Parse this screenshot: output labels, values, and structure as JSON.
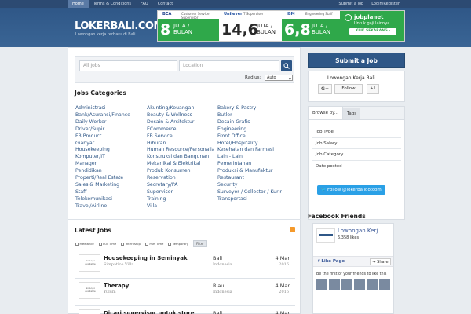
{
  "topnav": {
    "items": [
      "Home",
      "Terms & Conditions",
      "FAQ",
      "Contact"
    ],
    "right": [
      "Submit a Job",
      "Login/Register"
    ]
  },
  "header": {
    "logo": "LOKERBALI.COM",
    "tagline": "Lowongan kerja terbaru di Bali"
  },
  "ad": {
    "offers": [
      {
        "brand": "BCA",
        "position": "Customer Service Supervisor",
        "value": "8",
        "unit1": "JUTA /",
        "unit2": "BULAN"
      },
      {
        "brand": "Unilever",
        "position": "IT Supervisor",
        "value": "14,6",
        "unit1": "JUTA /",
        "unit2": "BULAN"
      },
      {
        "brand": "IBM",
        "position": "Engineering Staff",
        "value": "6,8",
        "unit1": "JUTA /",
        "unit2": "BULAN"
      }
    ],
    "jobplanet": {
      "name": "jobplanet",
      "sub": "Untuk gaji lainnya",
      "button": "KLIK SEKARANG ›"
    }
  },
  "search": {
    "jobs_placeholder": "All Jobs",
    "location_placeholder": "Location",
    "radius_label": "Radius:",
    "radius_value": "Auto"
  },
  "categories": {
    "title": "Jobs Categories",
    "col1": [
      "Administrasi",
      "Bank/Asuransi/Finance",
      "Daily Worker",
      "Driver/Supir",
      "FB Product",
      "Gianyar",
      "Housekeeping",
      "Komputer/IT",
      "Manager",
      "Pendidikan",
      "Properti/Real Estate",
      "Sales & Marketing",
      "Staff",
      "Telekomunikasi",
      "Travel/Airline"
    ],
    "col2": [
      "Akunting/Keuangan",
      "Beauty & Wellness",
      "Desain & Arsitektur",
      "ECommerce",
      "FB Service",
      "Hiburan",
      "Human Resource/Personalia",
      "Konstruksi dan Bangunan",
      "Mekanikal & Elektrikal",
      "Produk Konsumen",
      "Reservation",
      "Secretary/PA",
      "Supervisor",
      "Training",
      "Villa"
    ],
    "col3": [
      "Bakery & Pastry",
      "Butler",
      "Desain Grafis",
      "Engineering",
      "Front Office",
      "Hotel/Hospitality",
      "Kesehatan dan Farmasi",
      "Lain - Lain",
      "Pemerintahan",
      "Produksi & Manufaktur",
      "Restaurant",
      "Security",
      "Surveyor / Collector / Kurir",
      "Transportasi"
    ]
  },
  "latest": {
    "title": "Latest Jobs",
    "filters": [
      "Freelance",
      "Full Time",
      "Internship",
      "Part Time",
      "Temporary"
    ],
    "filter_button": "Filter",
    "jobs": [
      {
        "title": "Housekeeping in Seminyak",
        "company": "Simpatico Villa",
        "location": "Bali",
        "country": "Indonesia",
        "date": "4 Mar",
        "year": "2016",
        "logo": "No Logo Available"
      },
      {
        "title": "Therapy",
        "company": "Yulum",
        "location": "Riau",
        "country": "Indonesia",
        "date": "4 Mar",
        "year": "2016",
        "logo": "No Logo Available"
      },
      {
        "title": "Dicari supervisor untuk store",
        "company": "",
        "location": "Bali",
        "country": "",
        "date": "4 Mar",
        "year": "",
        "logo": "No Logo Available"
      }
    ]
  },
  "sidebar": {
    "submit_button": "Submit a Job",
    "gplus": {
      "name": "Lowongan Kerja Bali",
      "logo": "G+",
      "follow": "Follow",
      "plus": "+1"
    },
    "browse": {
      "tabs": [
        "Browse by...",
        "Tags"
      ],
      "items": [
        "Job Type",
        "Job Salary",
        "Job Category",
        "Date posted"
      ]
    },
    "twitter": "Follow @lokerbalidotcom",
    "facebook": {
      "title": "Facebook Friends",
      "page_name": "Lowongan Kerj...",
      "likes": "6,358 likes",
      "like_btn": "Like Page",
      "share_btn": "Share",
      "friends_text": "Be the first of your friends to like this"
    }
  }
}
